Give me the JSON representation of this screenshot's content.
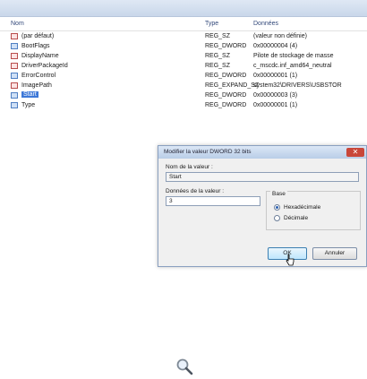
{
  "columns": {
    "name": "Nom",
    "type": "Type",
    "data": "Données"
  },
  "rows": [
    {
      "name": "(par défaut)",
      "type": "REG_SZ",
      "data": "(valeur non définie)",
      "icon": "string-value-icon"
    },
    {
      "name": "BootFlags",
      "type": "REG_DWORD",
      "data": "0x00000004 (4)",
      "icon": "binary-value-icon"
    },
    {
      "name": "DisplayName",
      "type": "REG_SZ",
      "data": "Pilote de stockage de masse",
      "icon": "string-value-icon"
    },
    {
      "name": "DriverPackageId",
      "type": "REG_SZ",
      "data": "c_mscdc.inf_amd64_neutral",
      "icon": "string-value-icon"
    },
    {
      "name": "ErrorControl",
      "type": "REG_DWORD",
      "data": "0x00000001 (1)",
      "icon": "binary-value-icon"
    },
    {
      "name": "ImagePath",
      "type": "REG_EXPAND_SZ",
      "data": "system32\\DRIVERS\\USBSTOR",
      "icon": "string-value-icon"
    },
    {
      "name": "Start",
      "type": "REG_DWORD",
      "data": "0x00000003 (3)",
      "icon": "binary-value-icon",
      "selected": true
    },
    {
      "name": "Type",
      "type": "REG_DWORD",
      "data": "0x00000001 (1)",
      "icon": "binary-value-icon"
    }
  ],
  "dialog": {
    "title": "Modifier la valeur DWORD 32 bits",
    "close": "✕",
    "name_label": "Nom de la valeur :",
    "name_value": "Start",
    "data_label": "Données de la valeur :",
    "data_value": "3",
    "base_label": "Base",
    "base_options": [
      "Hexadécimale",
      "Décimale"
    ],
    "base_selected": "Hexadécimale",
    "ok_label": "OK",
    "cancel_label": "Annuler"
  },
  "colors": {
    "selection": "#3d78d8",
    "title_bar": "#b9cde8",
    "close": "#c9473a"
  },
  "icons": {
    "search": "magnifier-icon"
  }
}
